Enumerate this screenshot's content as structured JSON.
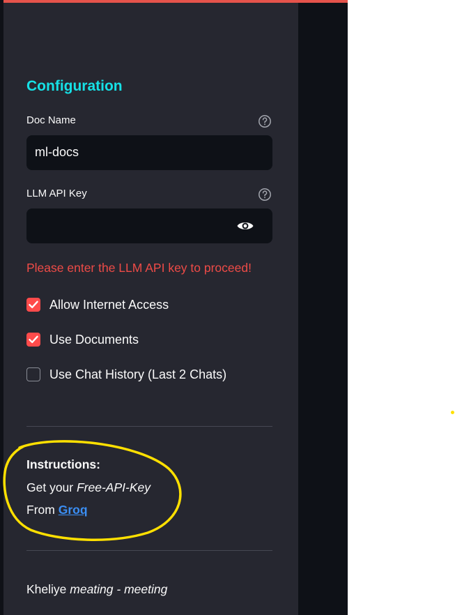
{
  "sidebar": {
    "title": "Configuration",
    "doc_name": {
      "label": "Doc Name",
      "value": "ml-docs",
      "help_icon": "question-circle-icon"
    },
    "api_key": {
      "label": "LLM API Key",
      "value": "",
      "help_icon": "question-circle-icon",
      "visibility_icon": "eye-icon"
    },
    "error": "Please enter the LLM API key to proceed!",
    "checkboxes": [
      {
        "label": "Allow Internet Access",
        "checked": true
      },
      {
        "label": "Use Documents",
        "checked": true
      },
      {
        "label": "Use Chat History (Last 2 Chats)",
        "checked": false
      }
    ],
    "instructions": {
      "title": "Instructions:",
      "line1_prefix": "Get your ",
      "line1_em": "Free-API-Key",
      "line2_prefix": "From ",
      "link_text": "Groq"
    },
    "footer": {
      "prefix": "Kheliye ",
      "em": "meating - meeting"
    }
  },
  "colors": {
    "sidebar_bg": "#262730",
    "main_bg": "#0e1117",
    "title": "#16e0e5",
    "error": "#ee4b47",
    "checkbox_on": "#ff4b4b",
    "link": "#3b8ff5",
    "annotation": "#ffe000",
    "top_accent": "#e5534b"
  }
}
